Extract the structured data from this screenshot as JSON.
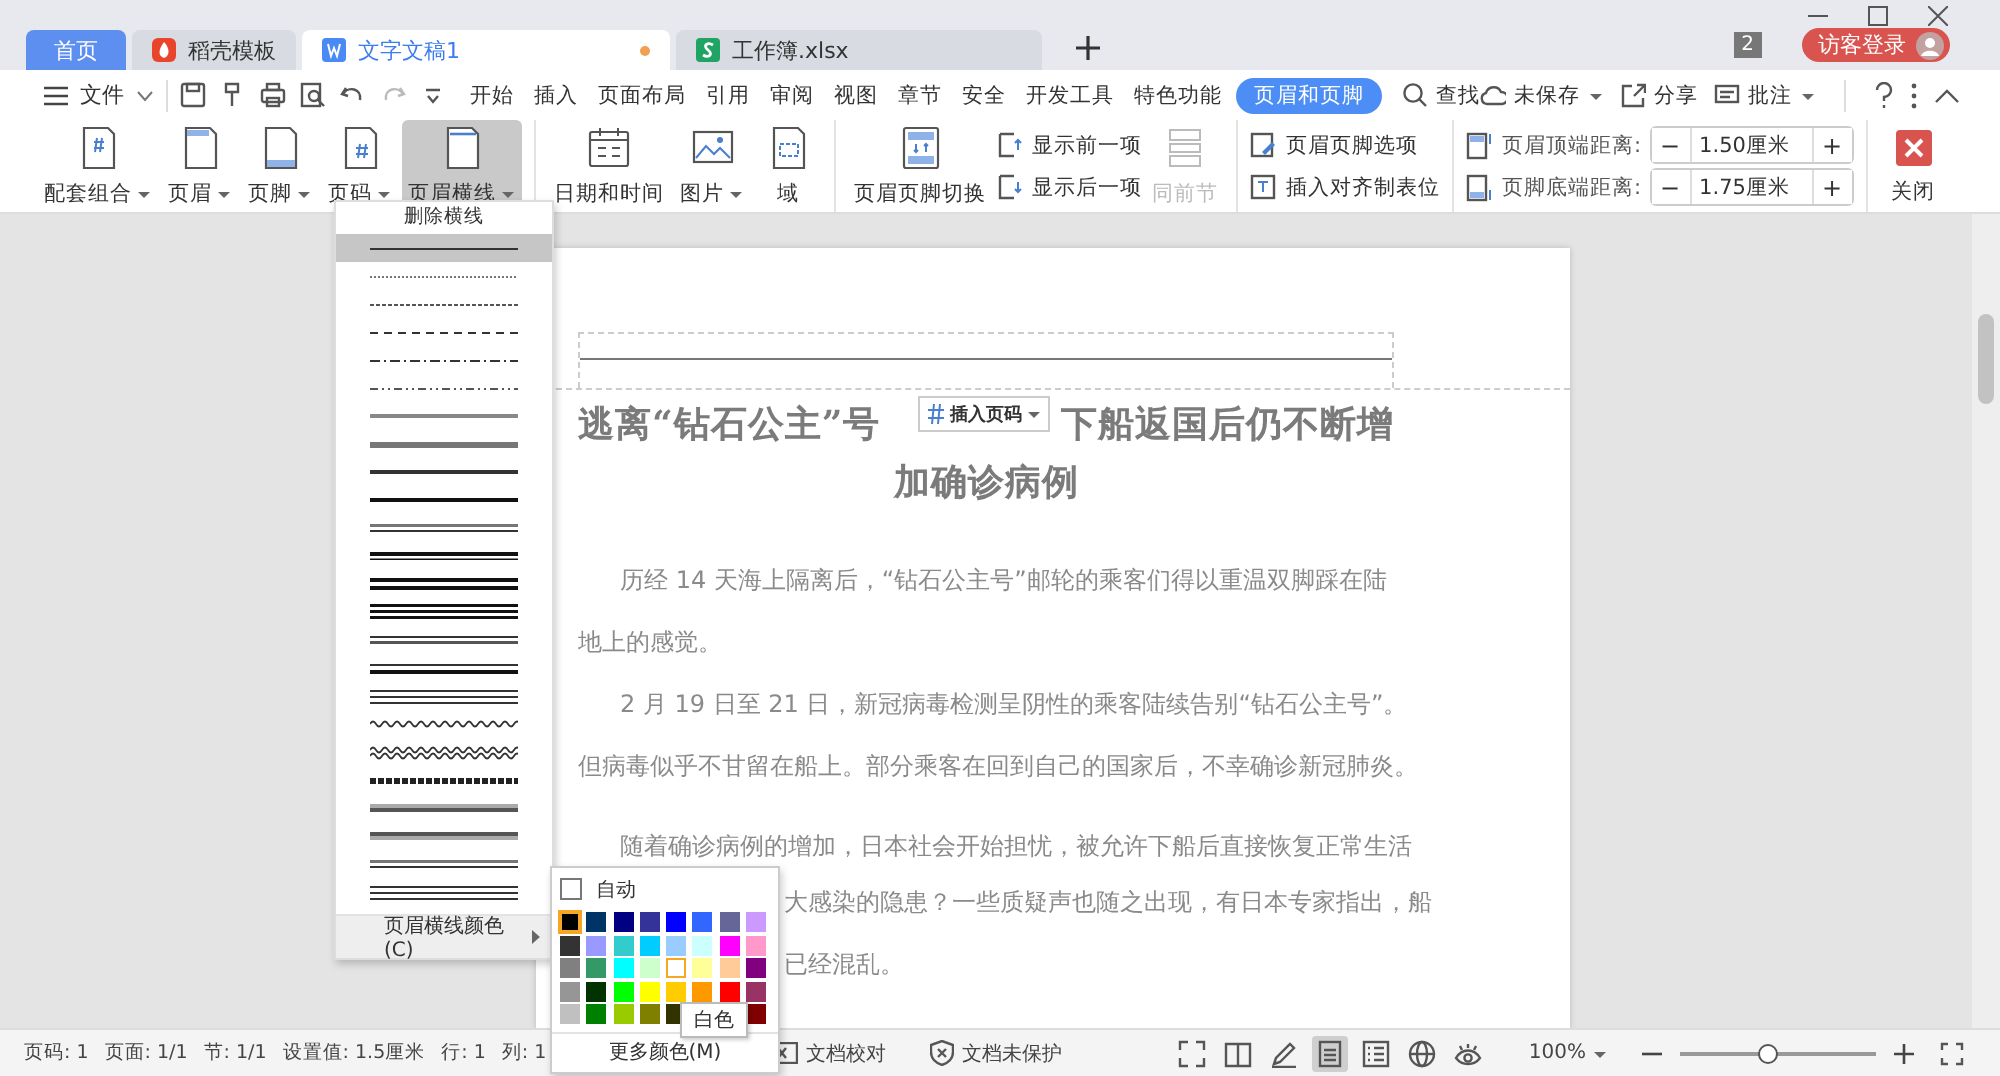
{
  "tabs": [
    {
      "label": "首页",
      "kind": "home",
      "selected": false,
      "unsaved": false
    },
    {
      "label": "稻壳模板",
      "kind": "docer",
      "selected": false,
      "unsaved": false
    },
    {
      "label": "文字文稿1",
      "kind": "writer",
      "selected": true,
      "unsaved": true
    },
    {
      "label": "工作簿.xlsx",
      "kind": "sheet",
      "selected": false,
      "unsaved": false
    }
  ],
  "window_count": "2",
  "login_button": "访客登录",
  "menu_bar": {
    "file": "文件",
    "items": [
      {
        "label": "开始",
        "selected": false
      },
      {
        "label": "插入",
        "selected": false
      },
      {
        "label": "页面布局",
        "selected": false
      },
      {
        "label": "引用",
        "selected": false
      },
      {
        "label": "审阅",
        "selected": false
      },
      {
        "label": "视图",
        "selected": false
      },
      {
        "label": "章节",
        "selected": false
      },
      {
        "label": "安全",
        "selected": false
      },
      {
        "label": "开发工具",
        "selected": false
      },
      {
        "label": "特色功能",
        "selected": false
      },
      {
        "label": "页眉和页脚",
        "selected": true
      }
    ],
    "search": "查找",
    "actions": [
      {
        "label": "未保存",
        "dropdown": true
      },
      {
        "label": "分享",
        "dropdown": false
      },
      {
        "label": "批注",
        "dropdown": true
      }
    ]
  },
  "ribbon": [
    [
      {
        "kind": "big",
        "label": "配套组合",
        "dropdown": true,
        "pressed": false,
        "disabled": false
      },
      {
        "kind": "big",
        "label": "页眉",
        "dropdown": true,
        "pressed": false,
        "disabled": false
      },
      {
        "kind": "big",
        "label": "页脚",
        "dropdown": true,
        "pressed": false,
        "disabled": false
      },
      {
        "kind": "big",
        "label": "页码",
        "dropdown": true,
        "pressed": false,
        "disabled": false
      },
      {
        "kind": "big",
        "label": "页眉横线",
        "dropdown": true,
        "pressed": true,
        "disabled": false
      }
    ],
    [
      {
        "kind": "big",
        "label": "日期和时间",
        "dropdown": false,
        "pressed": false,
        "disabled": false
      },
      {
        "kind": "big",
        "label": "图片",
        "dropdown": true,
        "pressed": false,
        "disabled": false
      },
      {
        "kind": "big",
        "label": "域",
        "dropdown": false,
        "pressed": false,
        "disabled": false
      }
    ],
    [
      {
        "kind": "big",
        "label": "页眉页脚切换",
        "dropdown": false,
        "pressed": false,
        "disabled": false
      },
      {
        "kind": "stack",
        "items": [
          "显示前一项",
          "显示后一项"
        ]
      },
      {
        "kind": "big",
        "label": "同前节",
        "dropdown": false,
        "pressed": false,
        "disabled": true
      }
    ],
    [
      {
        "kind": "stack",
        "items": [
          "页眉页脚选项",
          "插入对齐制表位"
        ]
      }
    ],
    [
      {
        "kind": "spin",
        "rows": [
          {
            "label": "页眉顶端距离:",
            "value": "1.50厘米",
            "minus": "−",
            "plus": "+"
          },
          {
            "label": "页脚底端距离:",
            "value": "1.75厘米",
            "minus": "−",
            "plus": "+"
          }
        ]
      }
    ],
    [
      {
        "kind": "close",
        "label": "关闭"
      }
    ]
  ],
  "header_line_menu": {
    "remove": "删除横线",
    "styles": [
      {
        "kind": "solid",
        "selected": true
      },
      {
        "kind": "dot",
        "selected": false
      },
      {
        "kind": "dot-fine",
        "selected": false
      },
      {
        "kind": "dash",
        "selected": false
      },
      {
        "kind": "dash-dot",
        "selected": false
      },
      {
        "kind": "dash-dot-dot",
        "selected": false
      },
      {
        "kind": "thick-gray",
        "selected": false
      },
      {
        "kind": "thick-gray-dark",
        "selected": false
      },
      {
        "kind": "thick",
        "selected": false
      },
      {
        "kind": "thicker",
        "selected": false
      },
      {
        "kind": "double-gray",
        "selected": false
      },
      {
        "kind": "double",
        "selected": false
      },
      {
        "kind": "double-thick",
        "selected": false
      },
      {
        "kind": "triple-thick",
        "selected": false
      },
      {
        "kind": "double-thin",
        "selected": false
      },
      {
        "kind": "thin-thick",
        "selected": false
      },
      {
        "kind": "triple",
        "selected": false
      },
      {
        "kind": "wave",
        "selected": false
      },
      {
        "kind": "double-wave",
        "selected": false
      },
      {
        "kind": "hatch",
        "selected": false
      },
      {
        "kind": "gradient",
        "selected": false
      },
      {
        "kind": "gradient-dark",
        "selected": false
      },
      {
        "kind": "double-gray",
        "selected": false
      },
      {
        "kind": "triple",
        "selected": false
      }
    ],
    "color_item": "页眉横线颜色(C)"
  },
  "color_menu": {
    "auto": {
      "label": "自动",
      "checked": false
    },
    "swatches": [
      [
        {
          "color": "#000000",
          "selected": true,
          "hovered": false
        },
        {
          "color": "#003366",
          "selected": false,
          "hovered": false
        },
        {
          "color": "#000080",
          "selected": false,
          "hovered": false
        },
        {
          "color": "#333399",
          "selected": false,
          "hovered": false
        },
        {
          "color": "#0000ff",
          "selected": false,
          "hovered": false
        },
        {
          "color": "#3366ff",
          "selected": false,
          "hovered": false
        },
        {
          "color": "#666699",
          "selected": false,
          "hovered": false
        },
        {
          "color": "#cc99ff",
          "selected": false,
          "hovered": false
        }
      ],
      [
        {
          "color": "#333333",
          "selected": false,
          "hovered": false
        },
        {
          "color": "#9999ff",
          "selected": false,
          "hovered": false
        },
        {
          "color": "#33cccc",
          "selected": false,
          "hovered": false
        },
        {
          "color": "#00ccff",
          "selected": false,
          "hovered": false
        },
        {
          "color": "#99ccff",
          "selected": false,
          "hovered": false
        },
        {
          "color": "#ccffff",
          "selected": false,
          "hovered": false
        },
        {
          "color": "#ff00ff",
          "selected": false,
          "hovered": false
        },
        {
          "color": "#ff99cc",
          "selected": false,
          "hovered": false
        }
      ],
      [
        {
          "color": "#808080",
          "selected": false,
          "hovered": false
        },
        {
          "color": "#339966",
          "selected": false,
          "hovered": false
        },
        {
          "color": "#00ffff",
          "selected": false,
          "hovered": false
        },
        {
          "color": "#ccffcc",
          "selected": false,
          "hovered": false
        },
        {
          "color": "#ffffff",
          "selected": false,
          "hovered": true
        },
        {
          "color": "#ffff99",
          "selected": false,
          "hovered": false
        },
        {
          "color": "#ffcc99",
          "selected": false,
          "hovered": false
        },
        {
          "color": "#800080",
          "selected": false,
          "hovered": false
        }
      ],
      [
        {
          "color": "#969696",
          "selected": false,
          "hovered": false
        },
        {
          "color": "#003300",
          "selected": false,
          "hovered": false
        },
        {
          "color": "#00ff00",
          "selected": false,
          "hovered": false
        },
        {
          "color": "#ffff00",
          "selected": false,
          "hovered": false
        },
        {
          "color": "#ffcc00",
          "selected": false,
          "hovered": false
        },
        {
          "color": "#ff9900",
          "selected": false,
          "hovered": false
        },
        {
          "color": "#ff0000",
          "selected": false,
          "hovered": false
        },
        {
          "color": "#993366",
          "selected": false,
          "hovered": false
        }
      ],
      [
        {
          "color": "#c0c0c0",
          "selected": false,
          "hovered": false
        },
        {
          "color": "#008000",
          "selected": false,
          "hovered": false
        },
        {
          "color": "#99cc00",
          "selected": false,
          "hovered": false
        },
        {
          "color": "#808000",
          "selected": false,
          "hovered": false
        },
        {
          "color": "#333300",
          "selected": false,
          "hovered": false
        },
        {
          "color": "#800000",
          "selected": false,
          "hovered": false
        }
      ]
    ],
    "tooltip": "白色",
    "more": "更多颜色(M)"
  },
  "document": {
    "insert_page_number": "插入页码",
    "title_line1_start": "逃离“钻石公主”号",
    "title_line1_end": "下船返国后仍不断增",
    "title_line2": "加确诊病例",
    "lines": [
      {
        "text": "历经 14 天海上隔离后，“钻石公主号”邮轮的乘客们得以重温双脚踩在陆",
        "kind": "indent"
      },
      {
        "text": "地上的感觉。",
        "kind": "plain"
      },
      {
        "text": "2 月 19 日至 21 日，新冠病毒检测呈阴性的乘客陆续告别“钻石公主号”。",
        "kind": "indent"
      },
      {
        "text": "但病毒似乎不甘留在船上。部分乘客在回到自己的国家后，不幸确诊新冠肺炎。",
        "kind": "plain"
      },
      {
        "text": "随着确诊病例的增加，日本社会开始担忧，被允许下船后直接恢复正常生活",
        "kind": "new-paragraph"
      },
      {
        "text": "大感染的隐患？一些质疑声也随之出现，有日本专家指出，船",
        "kind": "after-menu"
      },
      {
        "text": "已经混乱。",
        "kind": "after-menu"
      }
    ]
  },
  "status_bar": {
    "fields": [
      "页码: 1",
      "页面: 1/1",
      "节: 1/1",
      "设置值: 1.5厘米",
      "行: 1",
      "列: 1"
    ],
    "proofread": "文档校对",
    "protection": "文档未保护",
    "views": [
      {
        "selected": false
      },
      {
        "selected": false
      },
      {
        "selected": false
      },
      {
        "selected": true
      },
      {
        "selected": false
      },
      {
        "selected": false
      },
      {
        "selected": false
      }
    ],
    "zoom": "100%",
    "zoom_slider": {
      "level": 0.45
    }
  }
}
